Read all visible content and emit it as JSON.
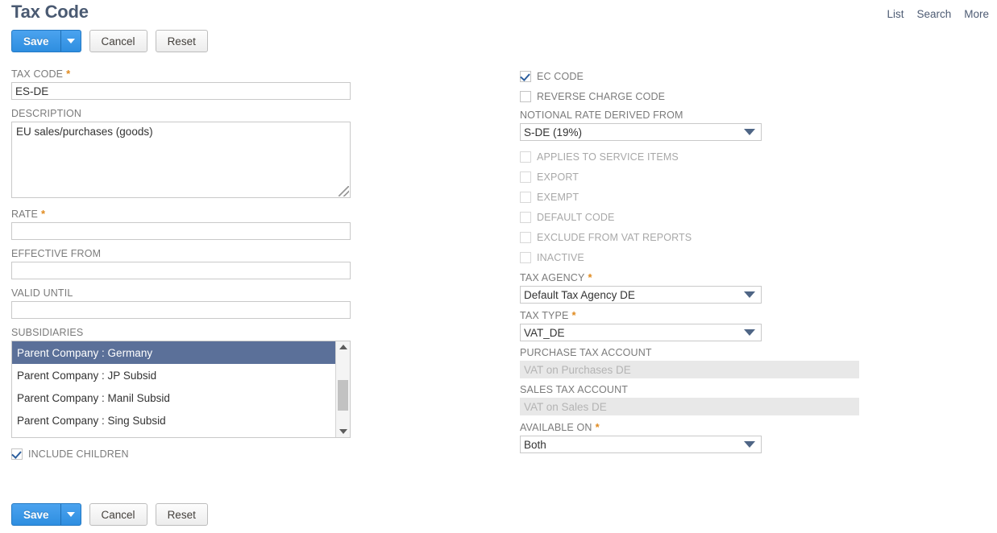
{
  "header": {
    "title": "Tax Code",
    "links": [
      {
        "label": "List",
        "name": "list"
      },
      {
        "label": "Search",
        "name": "search"
      },
      {
        "label": "More",
        "name": "more"
      }
    ]
  },
  "actions": {
    "save_label": "Save",
    "save_caret_icon": "caret-down-icon",
    "cancel_label": "Cancel",
    "reset_label": "Reset"
  },
  "left_column": {
    "tax_code": {
      "label": "TAX CODE",
      "required": true,
      "value": "ES-DE",
      "placeholder": ""
    },
    "description": {
      "label": "DESCRIPTION",
      "required": false,
      "value": "EU sales/purchases (goods)",
      "placeholder": ""
    },
    "rate": {
      "label": "RATE",
      "required": true,
      "value": "",
      "placeholder": ""
    },
    "effective_from": {
      "label": "EFFECTIVE FROM",
      "required": false,
      "value": "",
      "placeholder": ""
    },
    "valid_until": {
      "label": "VALID UNTIL",
      "required": false,
      "value": "",
      "placeholder": ""
    },
    "subsidiaries": {
      "label": "SUBSIDIARIES",
      "items": [
        {
          "label": "Parent Company : Germany",
          "selected": true
        },
        {
          "label": "Parent Company : JP Subsid",
          "selected": false
        },
        {
          "label": "Parent Company : Manil Subsid",
          "selected": false
        },
        {
          "label": "Parent Company : Sing Subsid",
          "selected": false
        }
      ],
      "scroll_up_icon": "scroll-up-arrow-icon",
      "scroll_down_icon": "scroll-down-arrow-icon"
    },
    "include_children": {
      "label": "INCLUDE CHILDREN",
      "checked": true,
      "disabled": false
    }
  },
  "right_column": {
    "ec_code": {
      "label": "EC CODE",
      "checked": true,
      "disabled": false
    },
    "reverse_charge_code": {
      "label": "REVERSE CHARGE CODE",
      "checked": false,
      "disabled": false
    },
    "notional_rate_derived_from": {
      "label": "NOTIONAL RATE DERIVED FROM",
      "required": false,
      "value": "S-DE (19%)",
      "caret_icon": "dropdown-caret-icon"
    },
    "applies_to_service_items": {
      "label": "APPLIES TO SERVICE ITEMS",
      "checked": false,
      "disabled": true
    },
    "export": {
      "label": "EXPORT",
      "checked": false,
      "disabled": true
    },
    "exempt": {
      "label": "EXEMPT",
      "checked": false,
      "disabled": true
    },
    "default_code": {
      "label": "DEFAULT CODE",
      "checked": false,
      "disabled": true
    },
    "exclude_from_vat_reports": {
      "label": "EXCLUDE FROM VAT REPORTS",
      "checked": false,
      "disabled": true
    },
    "inactive": {
      "label": "INACTIVE",
      "checked": false,
      "disabled": true
    },
    "tax_agency": {
      "label": "TAX AGENCY",
      "required": true,
      "value": "Default Tax Agency DE",
      "caret_icon": "dropdown-caret-icon"
    },
    "tax_type": {
      "label": "TAX TYPE",
      "required": true,
      "value": "VAT_DE",
      "caret_icon": "dropdown-caret-icon"
    },
    "purchase_tax_account": {
      "label": "PURCHASE TAX ACCOUNT",
      "required": false,
      "value": "VAT on Purchases DE",
      "disabled": true
    },
    "sales_tax_account": {
      "label": "SALES TAX ACCOUNT",
      "required": false,
      "value": "VAT on Sales DE",
      "disabled": true
    },
    "available_on": {
      "label": "AVAILABLE ON",
      "required": true,
      "value": "Both",
      "caret_icon": "dropdown-caret-icon"
    }
  },
  "colors": {
    "primary_button": "#2e8ee0",
    "title": "#4a5a72",
    "label": "#7b7b7b",
    "label_disabled": "#a8a8a8",
    "required_asterisk": "#e08a1e",
    "list_selected_bg": "#5b7099",
    "checkmark": "#2d5f9e",
    "dropdown_caret": "#4e6585"
  }
}
